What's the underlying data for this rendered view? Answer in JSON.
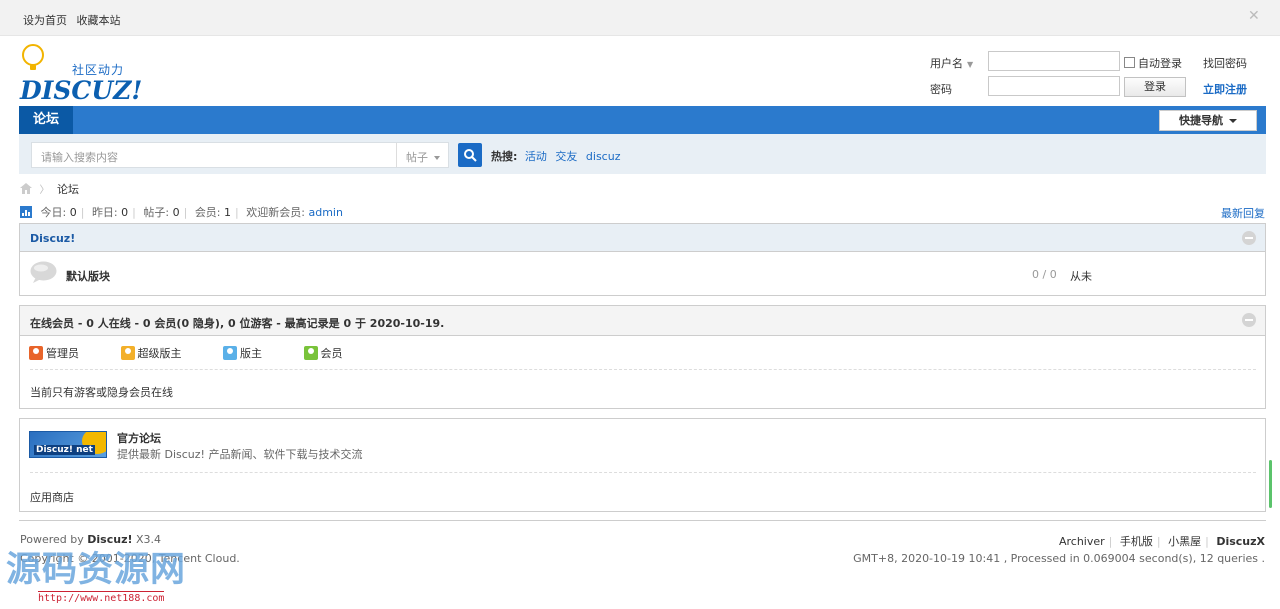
{
  "topbar": {
    "set_home": "设为首页",
    "bookmark": "收藏本站"
  },
  "logo": {
    "tagline": "社区动力",
    "brand": "DISCUZ!"
  },
  "login": {
    "username_label": "用户名",
    "password_label": "密码",
    "auto_login": "自动登录",
    "find_password": "找回密码",
    "login_button": "登录",
    "register": "立即注册",
    "username_value": "",
    "password_value": ""
  },
  "nav": {
    "forum_tab": "论坛",
    "quick_nav": "快捷导航"
  },
  "search": {
    "placeholder": "请输入搜索内容",
    "type": "帖子",
    "hot_label": "热搜:",
    "hot_keywords": [
      "活动",
      "交友",
      "discuz"
    ]
  },
  "breadcrumb": {
    "current": "论坛"
  },
  "stats": {
    "today_label": "今日:",
    "today": "0",
    "yesterday_label": "昨日:",
    "yesterday": "0",
    "posts_label": "帖子:",
    "posts": "0",
    "members_label": "会员:",
    "members": "1",
    "welcome_label": "欢迎新会员:",
    "newest_member": "admin",
    "latest_reply": "最新回复"
  },
  "forum_group": {
    "title": "Discuz!",
    "forums": [
      {
        "name": "默认版块",
        "counts": "0 / 0",
        "last_post": "从未"
      }
    ]
  },
  "online": {
    "title": "在线会员 - 0 人在线 - 0 会员(0 隐身), 0 位游客 - 最高记录是 0 于 2020-10-19.",
    "legend": [
      "管理员",
      "超级版主",
      "版主",
      "会员"
    ],
    "legend_colors": [
      "#e8642a",
      "#f3b02a",
      "#5ab0e8",
      "#79c33a"
    ],
    "note": "当前只有游客或隐身会员在线"
  },
  "links": {
    "banner_text": "Discuz! net",
    "title": "官方论坛",
    "description": "提供最新 Discuz! 产品新闻、软件下载与技术交流",
    "app_store": "应用商店"
  },
  "footer": {
    "powered_prefix": "Powered by",
    "powered_brand": "Discuz!",
    "version": "X3.4",
    "copyright": "Copyright © 2001-2020, Tencent Cloud.",
    "links": [
      "Archiver",
      "手机版",
      "小黑屋"
    ],
    "brand_link": "DiscuzX",
    "gmt": "GMT+8, 2020-10-19 10:41 , Processed in 0.069004 second(s), 12 queries ."
  },
  "watermark": {
    "text": "源码资源网",
    "url": "http://www.net188.com"
  },
  "colors": {
    "accent": "#2b7acd",
    "nav_active": "#0b59a5",
    "link": "#1b6bc5"
  }
}
